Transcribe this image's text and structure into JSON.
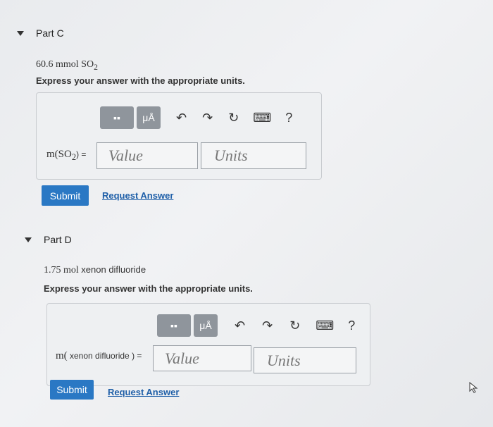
{
  "part_c": {
    "title": "Part C",
    "problem_value": "60.6 mmol SO",
    "problem_sub": "2",
    "instruction": "Express your answer with the appropriate units.",
    "toolbar": {
      "templates": "▪▪",
      "units": "μÅ",
      "undo": "↶",
      "redo": "↷",
      "reset": "↻",
      "keyboard": "⌨",
      "help": "?"
    },
    "label_prefix": "m(SO",
    "label_sub": "2",
    "label_suffix": ") =",
    "value_placeholder": "Value",
    "units_placeholder": "Units",
    "submit_label": "Submit",
    "request_answer": "Request Answer"
  },
  "part_d": {
    "title": "Part D",
    "problem_value": "1.75 mol",
    "problem_name": "xenon difluoride",
    "instruction": "Express your answer with the appropriate units.",
    "toolbar": {
      "templates": "▪▪",
      "units": "μÅ",
      "undo": "↶",
      "redo": "↷",
      "reset": "↻",
      "keyboard": "⌨",
      "help": "?"
    },
    "label_prefix": "m(",
    "label_name": " xenon difluoride ",
    "label_suffix": ") =",
    "value_placeholder": "Value",
    "units_placeholder": "Units",
    "submit_label": "Submit",
    "request_answer": "Request Answer"
  },
  "colors": {
    "submit_bg": "#2a78c4",
    "link": "#1f5fa8",
    "tool_btn": "#8f959c"
  }
}
